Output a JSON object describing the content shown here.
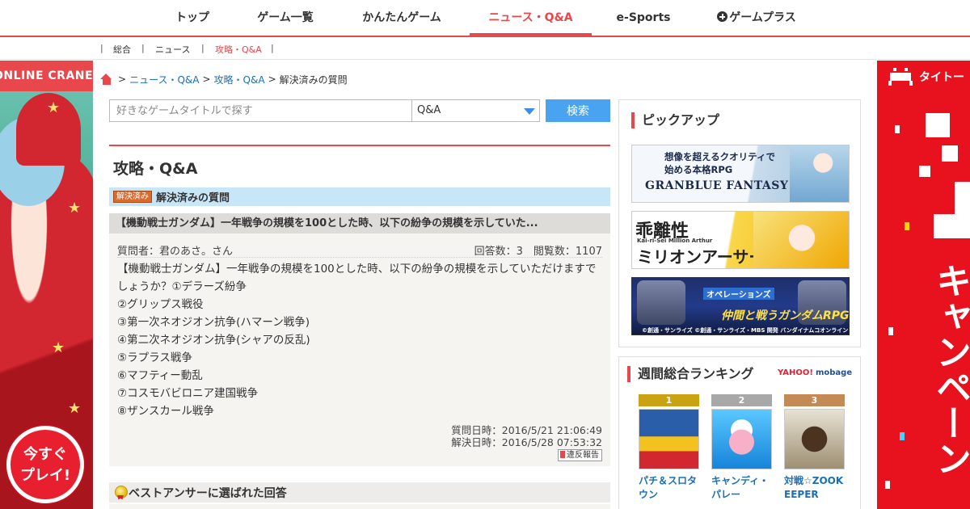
{
  "topnav": {
    "items": [
      {
        "label": "トップ"
      },
      {
        "label": "ゲーム一覧"
      },
      {
        "label": "かんたんゲーム"
      },
      {
        "label": "ニュース・Q&A",
        "active": true
      },
      {
        "label": "e-Sports"
      },
      {
        "label": "ゲームプラス"
      }
    ]
  },
  "subnav": {
    "separator": "|",
    "items": [
      {
        "label": "総合"
      },
      {
        "label": "ニュース"
      },
      {
        "label": "攻略・Q&A",
        "active": true
      }
    ]
  },
  "ads": {
    "left": {
      "brand": "ONLINE CRANE",
      "cta": "今すぐ\nプレイ!"
    },
    "right": {
      "brand": "タイトー",
      "text": "キャンペーン"
    }
  },
  "breadcrumb": {
    "sep": ">",
    "items": [
      "ニュース・Q&A",
      "攻略・Q&A"
    ],
    "current": "解決済みの質問"
  },
  "search": {
    "placeholder": "好きなゲームタイトルで探す",
    "category": "Q&A",
    "button": "検索"
  },
  "main": {
    "title": "攻略・Q&A",
    "section_badge": "解決済み",
    "section_label": "解決済みの質問",
    "question": {
      "title": "【機動戦士ガンダム】一年戦争の規模を100とした時、以下の紛争の規模を示していた...",
      "asker": "質問者：君のあさ。さん",
      "stats": "回答数：3　閲覧数：1107",
      "body": [
        "【機動戦士ガンダム】一年戦争の規模を100とした時、以下の紛争の規模を示していただけますでしょうか？①デラーズ紛争",
        "②グリップス戦役",
        "③第一次ネオジオン抗争(ハマーン戦争)",
        "④第二次ネオジオン抗争(シャアの反乱)",
        "⑤ラプラス戦争",
        "⑥マフティー動乱",
        "⑦コスモバビロニア建国戦争",
        "⑧ザンスカール戦争"
      ],
      "asked_at": "質問日時：2016/5/21 21:06:49",
      "resolved_at": "解決日時：2016/5/28 07:53:32",
      "report": "違反報告"
    },
    "best_answer_label": "ベストアンサーに選ばれた回答"
  },
  "sidebar": {
    "pickup": {
      "title": "ピックアップ",
      "banners": [
        {
          "line1": "想像を超えるクオリティで",
          "line2": "始める本格RPG",
          "logo": "GRANBLUE FANTASY"
        },
        {
          "logo1": "乖離性",
          "logo2": "ミリオンアーサー",
          "sub": "Kai-ri-Sei Million Arthur"
        },
        {
          "top": "オペレーションズ",
          "main": "仲間と戦うガンダムRPG",
          "copy": "©創通・サンライズ ©創通・サンライズ・MBS 開発 バンダイナムコオンライン"
        }
      ]
    },
    "ranking": {
      "title": "週間総合ランキング",
      "logo_yahoo": "YAHOO!",
      "logo_mobage": "mobage",
      "items": [
        {
          "rank": "1",
          "name": "パチ＆スロタウン"
        },
        {
          "rank": "2",
          "name": "キャンディ・パレー"
        },
        {
          "rank": "3",
          "name": "対戦☆ZOOKEEPER"
        }
      ]
    }
  }
}
